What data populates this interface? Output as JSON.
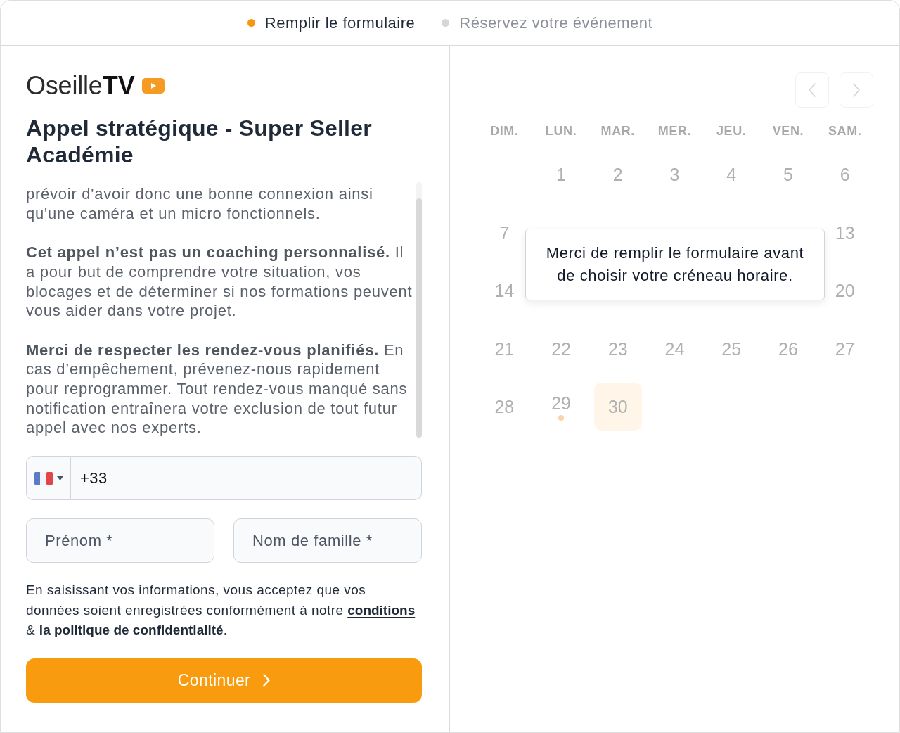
{
  "steps": [
    {
      "label": "Remplir le formulaire",
      "selected": true
    },
    {
      "label": "Réservez votre événement",
      "selected": false
    }
  ],
  "brand": {
    "logo": "Oseille**TV**"
  },
  "title": "Appel stratégique - Super Seller Académie",
  "description": [
    "prévoir d'avoir donc une bonne connexion ainsi qu'une caméra et un micro fonctionnels.",
    "**Cet appel n’est pas un coaching personnalisé.** Il a pour but de comprendre votre situation, vos blocages et de déterminer si nos formations peuvent vous aider dans votre projet.",
    "**Merci de respecter les rendez-vous planifiés.** En cas d’empêchement, prévenez-nous rapidement pour reprogrammer. Tout rendez-vous manqué sans notification entraînera votre exclusion de tout futur appel avec nos experts."
  ],
  "phone": {
    "value": "+33"
  },
  "name_fields": [
    {
      "placeholder": "Prénom *"
    },
    {
      "placeholder": "Nom de famille *"
    }
  ],
  "consent": [
    {
      "kind": "text",
      "text": "En saisissant vos informations, vous acceptez que vos données soient enregistrées conformément à notre "
    },
    {
      "kind": "link",
      "text": "conditions"
    },
    {
      "kind": "text",
      "text": " & "
    },
    {
      "kind": "link",
      "text": "la politique de confidentialité"
    },
    {
      "kind": "text",
      "text": "."
    }
  ],
  "submit": {
    "label": "Continuer"
  },
  "calendar": {
    "weekdays": [
      "DIM.",
      "LUN.",
      "MAR.",
      "MER.",
      "JEU.",
      "VEN.",
      "SAM."
    ],
    "weeks": [
      [
        {
          "kind": "blank"
        },
        {
          "kind": "day",
          "label": "1",
          "highlighted": false,
          "marked": false
        },
        {
          "kind": "day",
          "label": "2",
          "highlighted": false,
          "marked": false
        },
        {
          "kind": "day",
          "label": "3",
          "highlighted": false,
          "marked": false
        },
        {
          "kind": "day",
          "label": "4",
          "highlighted": false,
          "marked": false
        },
        {
          "kind": "day",
          "label": "5",
          "highlighted": false,
          "marked": false
        },
        {
          "kind": "day",
          "label": "6",
          "highlighted": false,
          "marked": false
        }
      ],
      [
        {
          "kind": "day",
          "label": "7",
          "highlighted": false,
          "marked": false
        },
        {
          "kind": "blank"
        },
        {
          "kind": "blank"
        },
        {
          "kind": "blank"
        },
        {
          "kind": "blank"
        },
        {
          "kind": "blank"
        },
        {
          "kind": "day",
          "label": "13",
          "highlighted": false,
          "marked": false
        }
      ],
      [
        {
          "kind": "day",
          "label": "14",
          "highlighted": false,
          "marked": false
        },
        {
          "kind": "blank"
        },
        {
          "kind": "blank"
        },
        {
          "kind": "blank"
        },
        {
          "kind": "blank"
        },
        {
          "kind": "blank"
        },
        {
          "kind": "day",
          "label": "20",
          "highlighted": false,
          "marked": false
        }
      ],
      [
        {
          "kind": "day",
          "label": "21",
          "highlighted": false,
          "marked": false
        },
        {
          "kind": "day",
          "label": "22",
          "highlighted": false,
          "marked": false
        },
        {
          "kind": "day",
          "label": "23",
          "highlighted": false,
          "marked": false
        },
        {
          "kind": "day",
          "label": "24",
          "highlighted": false,
          "marked": false
        },
        {
          "kind": "day",
          "label": "25",
          "highlighted": false,
          "marked": false
        },
        {
          "kind": "day",
          "label": "26",
          "highlighted": false,
          "marked": false
        },
        {
          "kind": "day",
          "label": "27",
          "highlighted": false,
          "marked": false
        }
      ],
      [
        {
          "kind": "day",
          "label": "28",
          "highlighted": false,
          "marked": false
        },
        {
          "kind": "day",
          "label": "29",
          "highlighted": false,
          "marked": true
        },
        {
          "kind": "day",
          "label": "30",
          "highlighted": true,
          "marked": false
        },
        {
          "kind": "blank"
        },
        {
          "kind": "blank"
        },
        {
          "kind": "blank"
        },
        {
          "kind": "blank"
        }
      ]
    ],
    "tooltip": "Merci de remplir le formulaire avant de choisir votre créneau horaire."
  }
}
